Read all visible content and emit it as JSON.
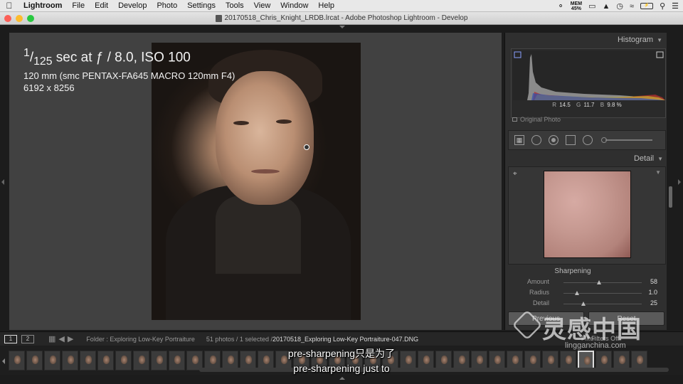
{
  "menubar": {
    "app": "Lightroom",
    "items": [
      "File",
      "Edit",
      "Develop",
      "Photo",
      "Settings",
      "Tools",
      "View",
      "Window",
      "Help"
    ],
    "mem_label": "MEM",
    "mem_value": "45%"
  },
  "window": {
    "title": "20170518_Chris_Knight_LRDB.lrcat - Adobe Photoshop Lightroom - Develop"
  },
  "info_overlay": {
    "exposure_num": "1",
    "exposure_den": "125",
    "exposure_rest": " sec at ƒ / 8.0, ISO 100",
    "lens": "120 mm (smc PENTAX-FA645 MACRO 120mm F4)",
    "dimensions": "6192 x 8256"
  },
  "histogram": {
    "header": "Histogram",
    "r_label": "R",
    "r_value": "14.5",
    "g_label": "G",
    "g_value": "11.7",
    "b_label": "B",
    "b_value": "9.8 %",
    "original_photo": "Original Photo"
  },
  "detail": {
    "header": "Detail",
    "sharpening_title": "Sharpening",
    "sliders": [
      {
        "label": "Amount",
        "value": "58",
        "fraction": 0.45
      },
      {
        "label": "Radius",
        "value": "1.0",
        "fraction": 0.17
      },
      {
        "label": "Detail",
        "value": "25",
        "fraction": 0.25
      }
    ]
  },
  "buttons": {
    "previous": "Previous",
    "reset": "Reset"
  },
  "filmstrip_bar": {
    "view1": "1",
    "view2": "2",
    "folder": "Folder : Exploring Low-Key Portraiture",
    "count": "51 photos / 1 selected /",
    "filename": "20170518_Exploring Low-Key Portraiture-047.DNG",
    "filter_label": "Filter :",
    "filter_value": "Filters Off"
  },
  "filmstrip": {
    "thumb_count": 36,
    "selected_index": 32
  },
  "subtitles": {
    "line1": "pre-sharpening只是为了",
    "line2": "pre-sharpening just to"
  },
  "watermark": {
    "cn": "灵感中国",
    "en": "lingganchina.com"
  }
}
